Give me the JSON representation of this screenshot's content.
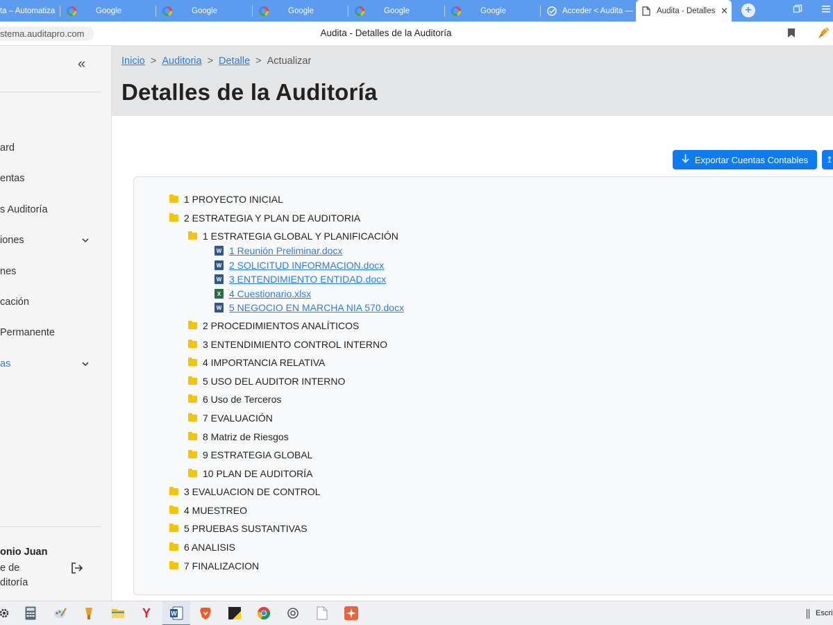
{
  "browser": {
    "tabs": [
      {
        "title": "ta – Automatiza",
        "icon": "page-icon"
      },
      {
        "title": "Google",
        "icon": "google-icon"
      },
      {
        "title": "Google",
        "icon": "google-icon"
      },
      {
        "title": "Google",
        "icon": "google-icon"
      },
      {
        "title": "Google",
        "icon": "google-icon"
      },
      {
        "title": "Google",
        "icon": "google-icon"
      },
      {
        "title": "Acceder < Audita —",
        "icon": "check-icon"
      },
      {
        "title": "Audita - Detalles",
        "icon": "page-icon",
        "active": true
      }
    ],
    "url": "stema.auditapro.com",
    "page_title": "Audita - Detalles de la Auditoría"
  },
  "sidebar": {
    "items": [
      {
        "label": "ard",
        "chevron": false
      },
      {
        "label": "entas",
        "chevron": false
      },
      {
        "label": "s Auditoría",
        "chevron": false
      },
      {
        "label": "iones",
        "chevron": true
      },
      {
        "label": "nes",
        "chevron": false
      },
      {
        "label": "cación",
        "chevron": false
      },
      {
        "label": "Permanente",
        "chevron": false
      },
      {
        "label": "as",
        "chevron": true,
        "active": true
      }
    ],
    "user": {
      "name": "onio Juan",
      "role_line1": "e de",
      "role_line2": "ditoría"
    }
  },
  "header": {
    "breadcrumb": {
      "inicio": "Inicio",
      "auditoria": "Auditoria",
      "detalle": "Detalle",
      "current": "Actualizar",
      "sep": ">"
    },
    "title": "Detalles de la Auditoría"
  },
  "actions": {
    "export_label": "Exportar Cuentas Contables"
  },
  "tree": {
    "top1": "1 PROYECTO INICIAL",
    "top2": "2 ESTRATEGIA Y PLAN DE AUDITORIA",
    "sub1": "1 ESTRATEGIA GLOBAL Y PLANIFICACIÓN",
    "files": [
      {
        "name": " 1 Reunión Preliminar.docx",
        "type": "W"
      },
      {
        "name": " 2 SOLICITUD INFORMACION.docx",
        "type": "W"
      },
      {
        "name": " 3 ENTENDIMIENTO ENTIDAD.docx",
        "type": "W"
      },
      {
        "name": " 4 Cuestionario.xlsx",
        "type": "X"
      },
      {
        "name": " 5 NEGOCIO EN MARCHA NIA 570.docx",
        "type": "W"
      }
    ],
    "subs": [
      "2 PROCEDIMIENTOS ANALÍTICOS",
      "3 ENTENDIMIENTO CONTROL INTERNO",
      "4 IMPORTANCIA RELATIVA",
      "5 USO DEL AUDITOR INTERNO",
      "6 Uso de Terceros",
      "7 EVALUACIÓN",
      "8 Matriz de Riesgos",
      "9 ESTRATEGIA GLOBAL",
      "10 PLAN DE AUDITORÍA"
    ],
    "tops": [
      "3 EVALUACION DE CONTROL",
      "4 MUESTREO",
      "5 PRUEBAS SUSTANTIVAS",
      "6 ANALISIS",
      "7 FINALIZACION"
    ]
  },
  "taskbar": {
    "search_text": "Escrit"
  }
}
